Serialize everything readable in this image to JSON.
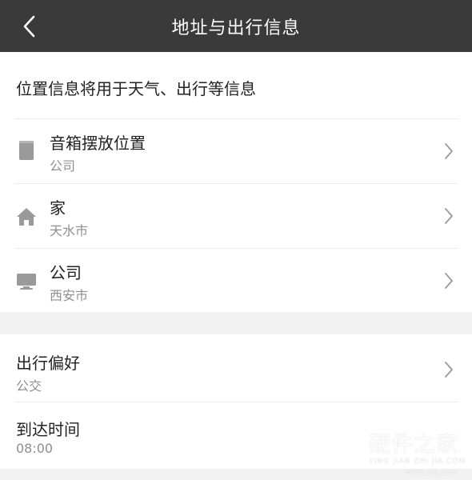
{
  "header": {
    "title": "地址与出行信息",
    "back_icon": "chevron-left-icon"
  },
  "notice": "位置信息将用于天气、出行等信息",
  "locations": [
    {
      "icon": "speaker-icon",
      "title": "音箱摆放位置",
      "subtitle": "公司"
    },
    {
      "icon": "home-icon",
      "title": "家",
      "subtitle": "天水市"
    },
    {
      "icon": "monitor-icon",
      "title": "公司",
      "subtitle": "西安市"
    }
  ],
  "preferences": [
    {
      "title": "出行偏好",
      "subtitle": "公交",
      "has_chevron": true
    },
    {
      "title": "到达时间",
      "subtitle": "08:00",
      "has_chevron": false
    }
  ],
  "watermark": {
    "main": "硬件之家",
    "pinyin": "YING JIAN ZHI JIA.COM",
    "url": "www.znj.com"
  },
  "colors": {
    "header_bg": "#3a3a3a",
    "page_bg": "#f2f2f2",
    "card_bg": "#ffffff",
    "icon_gray": "#9a9a9a",
    "subtitle_gray": "#8f8f8f"
  }
}
